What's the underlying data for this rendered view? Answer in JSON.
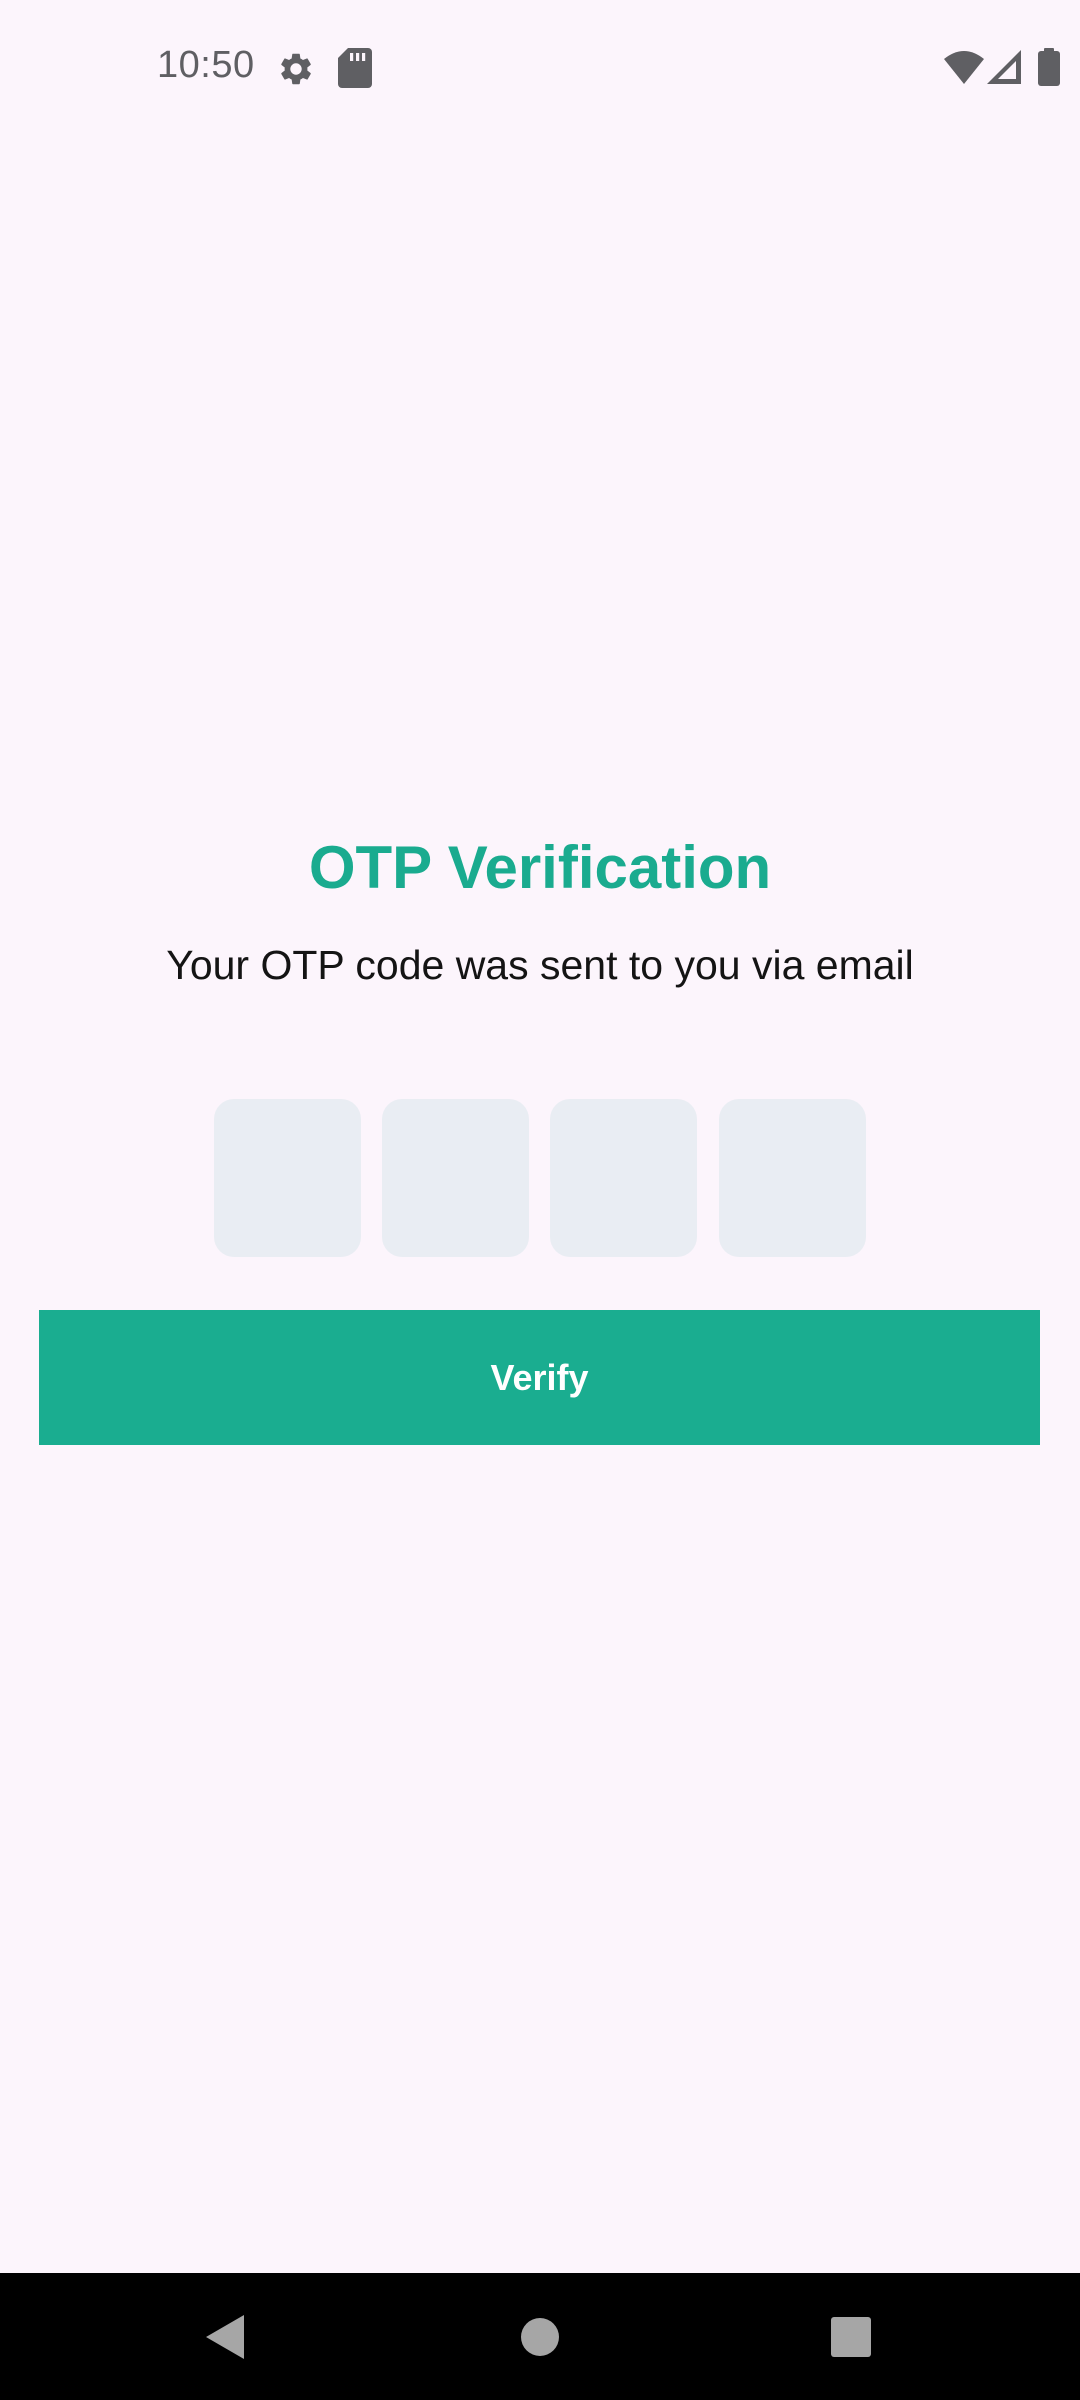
{
  "status_bar": {
    "time": "10:50",
    "left_icons": [
      "gear-icon",
      "sd-card-icon"
    ],
    "right_icons": [
      "wifi-icon",
      "cell-signal-icon",
      "battery-icon"
    ]
  },
  "main": {
    "title": "OTP Verification",
    "subtitle": "Your OTP code was sent to you via email",
    "otp_digits": [
      "",
      "",
      "",
      ""
    ],
    "verify_label": "Verify"
  },
  "nav_bar": {
    "buttons": [
      "back-icon",
      "home-icon",
      "recents-icon"
    ]
  },
  "colors": {
    "background": "#FCF5FC",
    "accent": "#1AAB8F",
    "otp_box": "#E9EDF3",
    "status_icon": "#5F5F63",
    "nav_bar": "#000000",
    "nav_icon": "#A6A6A6"
  }
}
